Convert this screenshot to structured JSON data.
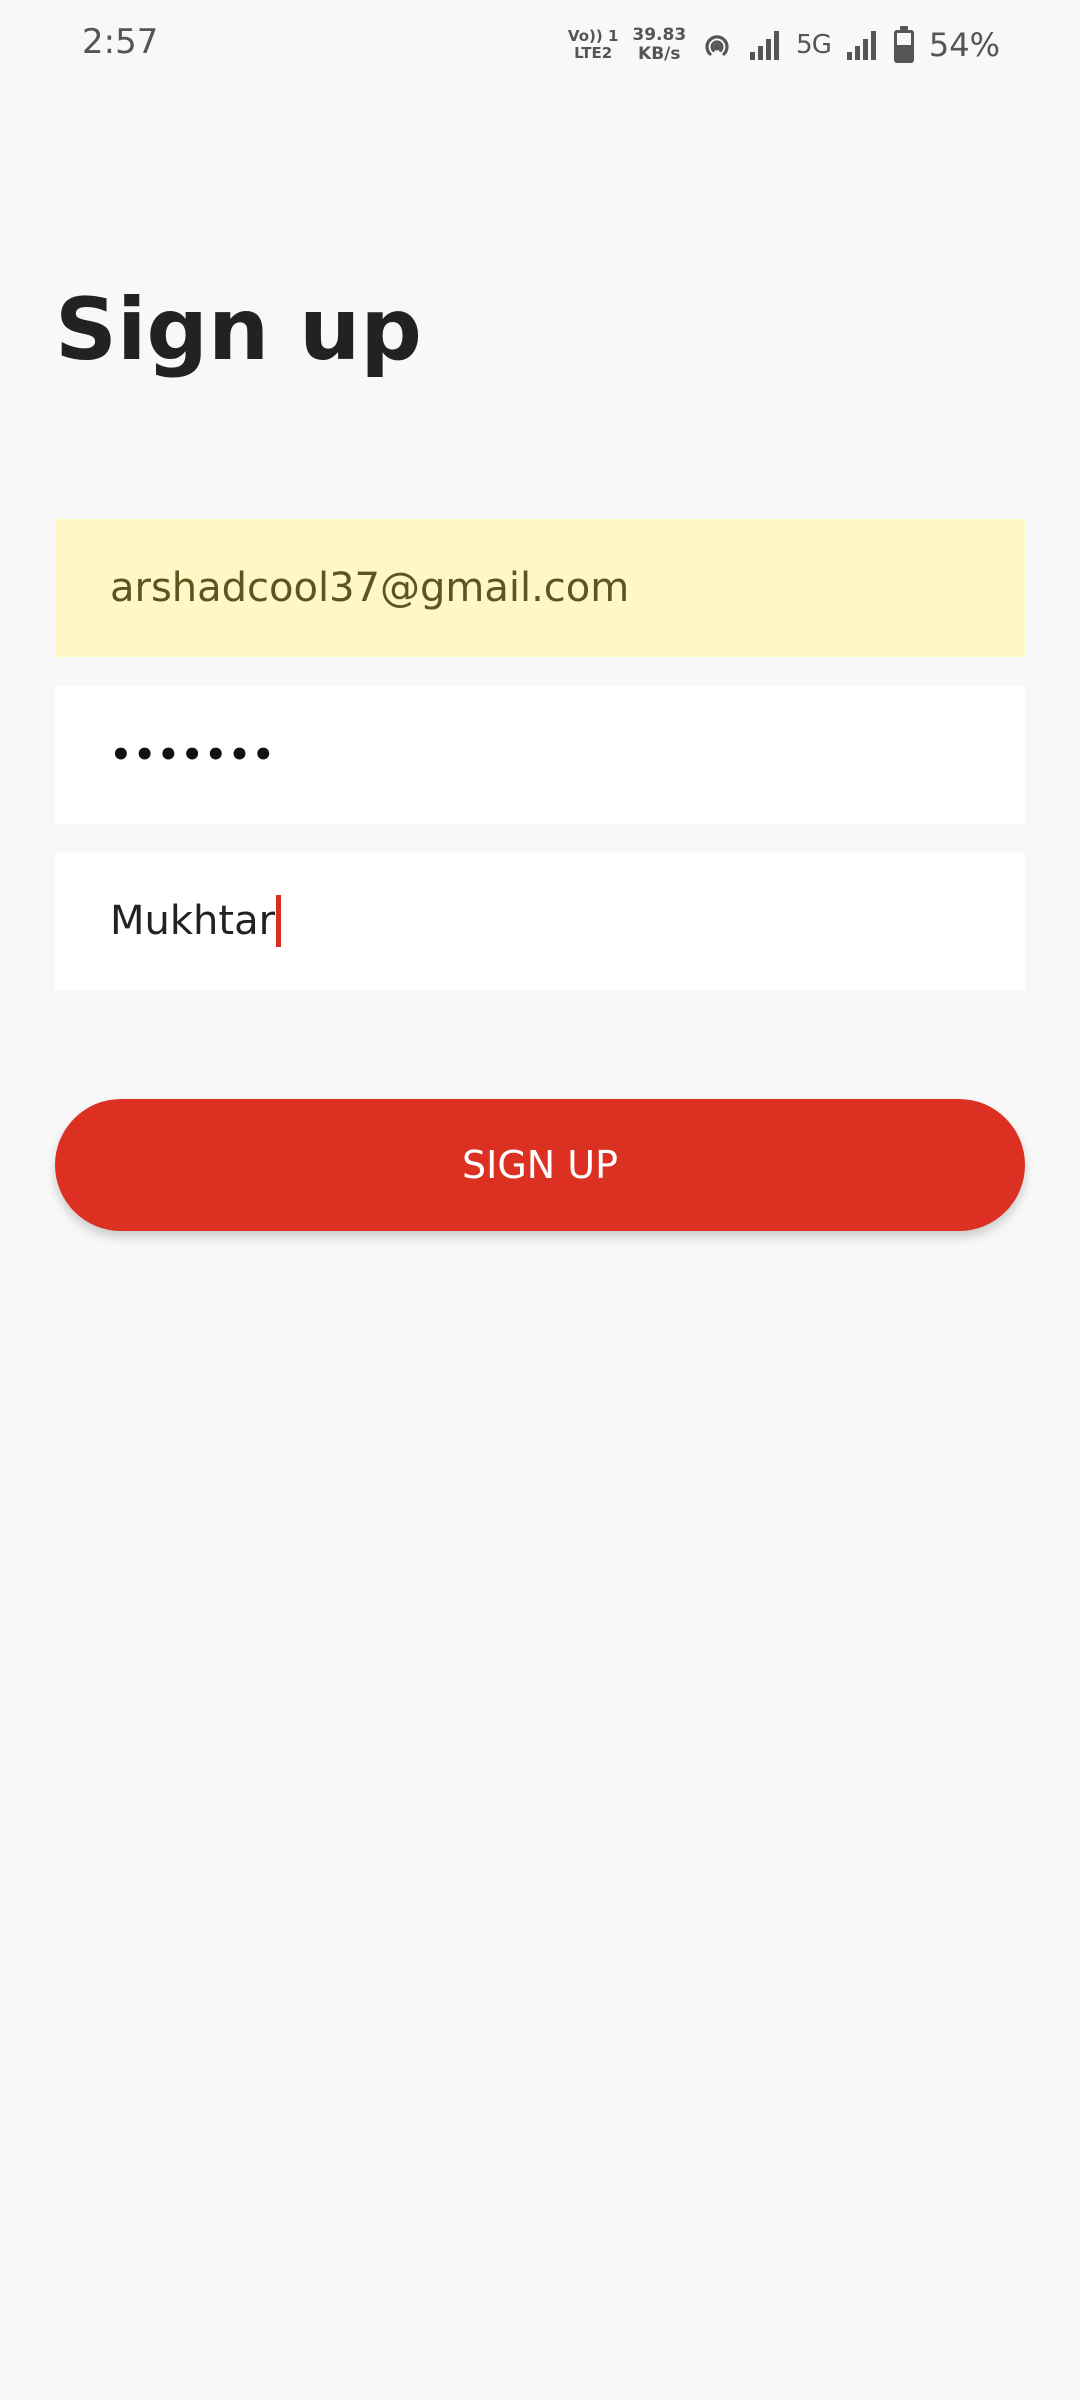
{
  "status_bar": {
    "time": "2:57",
    "volte_line1": "Vo)) 1",
    "volte_line2": "LTE2",
    "speed_value": "39.83",
    "speed_unit": "KB/s",
    "network_type": "5G",
    "battery_percent": "54%",
    "icons": [
      "hotspot-icon",
      "signal-icon",
      "signal-icon",
      "battery-icon"
    ]
  },
  "title": "Sign up",
  "form": {
    "email_value": "arshadcool37@gmail.com",
    "password_value": "•••••••",
    "name_value": "Mukhtar"
  },
  "button": {
    "label": "SIGN UP"
  },
  "colors": {
    "background": "#f8f8f8",
    "autofill": "#fff8c4",
    "accent": "#dc3022"
  }
}
